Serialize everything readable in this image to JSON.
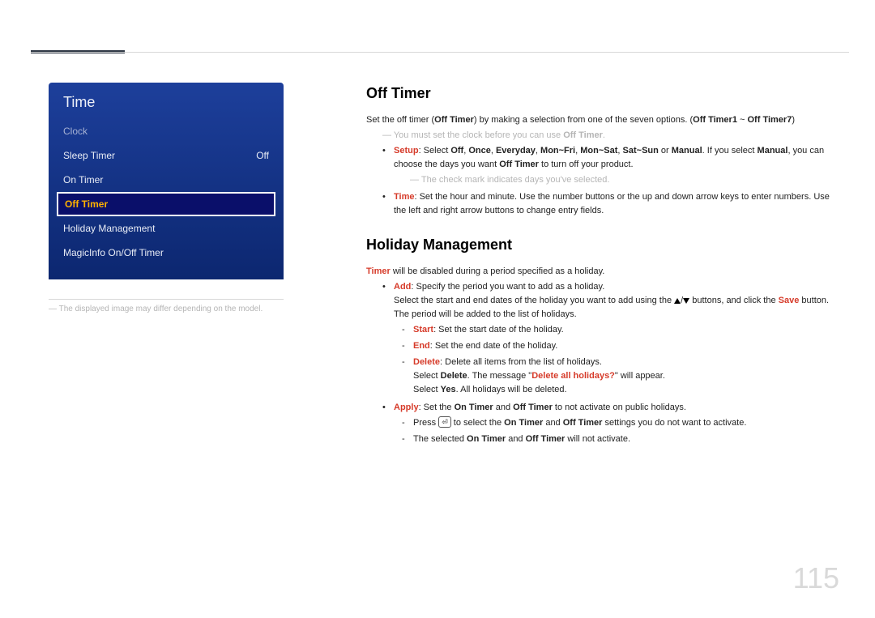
{
  "page_number": "115",
  "sidebar": {
    "title": "Time",
    "items": [
      {
        "label": "Clock",
        "value": ""
      },
      {
        "label": "Sleep Timer",
        "value": "Off"
      },
      {
        "label": "On Timer",
        "value": ""
      },
      {
        "label": "Off Timer",
        "value": ""
      },
      {
        "label": "Holiday Management",
        "value": ""
      },
      {
        "label": "MagicInfo On/Off Timer",
        "value": ""
      }
    ],
    "note": "―  The displayed image may differ depending on the model."
  },
  "offTimer": {
    "heading": "Off Timer",
    "intro_a": "Set the off timer (",
    "intro_b": "Off Timer",
    "intro_c": ") by making a selection from one of the seven options. (",
    "intro_d": "Off Timer1",
    "intro_e": " ~ ",
    "intro_f": "Off Timer7",
    "intro_g": ")",
    "note1_a": "―  You must set the clock before you can use ",
    "note1_b": "Off Timer",
    "note1_c": ".",
    "setup": {
      "label": "Setup",
      "a": ": Select ",
      "opts": {
        "off": "Off",
        "once": "Once",
        "everyday": "Everyday",
        "monfri": "Mon~Fri",
        "monsat": "Mon~Sat",
        "satsun": "Sat~Sun",
        "manual": "Manual"
      },
      "or": " or ",
      "b": ". If you select ",
      "c": ", you can choose the days you want ",
      "d": "Off Timer",
      "e": " to turn off your product."
    },
    "note2": "―  The check mark indicates days you've selected.",
    "time": {
      "label": "Time",
      "text": ": Set the hour and minute. Use the number buttons or the up and down arrow keys to enter numbers. Use the left and right arrow buttons to change entry fields."
    }
  },
  "holiday": {
    "heading": "Holiday Management",
    "intro_a": "Timer",
    "intro_b": " will be disabled during a period specified as a holiday.",
    "add": {
      "label": "Add",
      "a": ": Specify the period you want to add as a holiday.",
      "b1": "Select the start and end dates of the holiday you want to add using the ",
      "b2": " buttons, and click the ",
      "save": "Save",
      "b3": " button.",
      "c": "The period will be added to the list of holidays.",
      "start_l": "Start",
      "start_t": ": Set the start date of the holiday.",
      "end_l": "End",
      "end_t": ": Set the end date of the holiday.",
      "delete_l": "Delete",
      "delete_t": ": Delete all items from the list of holidays.",
      "del2a": "Select ",
      "del2b": "Delete",
      "del2c": ". The message \"",
      "del2d": "Delete all holidays?",
      "del2e": "\" will appear.",
      "del3a": "Select ",
      "del3b": "Yes",
      "del3c": ". All holidays will be deleted."
    },
    "apply": {
      "label": "Apply",
      "a": ": Set the ",
      "on": "On Timer",
      "and": " and ",
      "off": "Off Timer",
      "b": " to not activate on public holidays.",
      "p1a": "Press ",
      "p1b": " to select the ",
      "p1c": " settings you do not want to activate.",
      "p2a": "The selected ",
      "p2b": " will not activate."
    }
  }
}
